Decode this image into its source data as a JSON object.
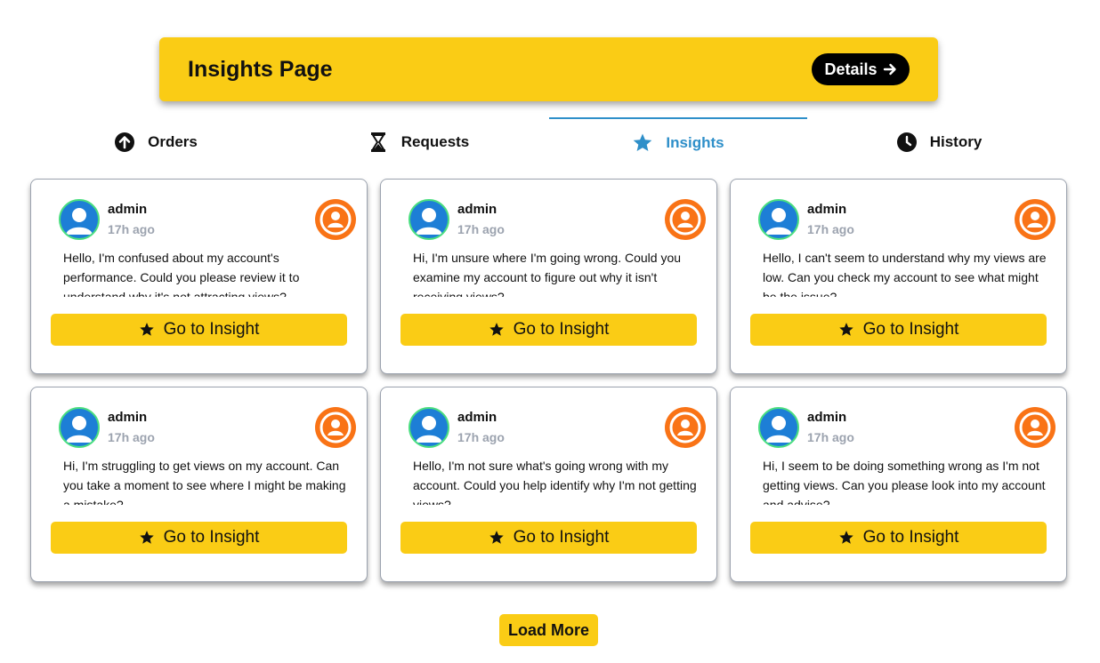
{
  "header": {
    "title": "Insights Page",
    "details_label": "Details",
    "details_icon": "arrow-right-icon"
  },
  "tabs": [
    {
      "label": "Orders",
      "icon": "arrow-up-circle-icon",
      "active": false
    },
    {
      "label": "Requests",
      "icon": "hourglass-icon",
      "active": false
    },
    {
      "label": "Insights",
      "icon": "star-icon",
      "active": true
    },
    {
      "label": "History",
      "icon": "clock-icon",
      "active": false
    }
  ],
  "cards": [
    {
      "user": "admin",
      "time": "17h ago",
      "message": "Hello, I'm confused about my account's performance. Could you please review it to understand why it's not attracting views?",
      "button": "Go to Insight"
    },
    {
      "user": "admin",
      "time": "17h ago",
      "message": "Hi, I'm unsure where I'm going wrong. Could you examine my account to figure out why it isn't receiving views?",
      "button": "Go to Insight"
    },
    {
      "user": "admin",
      "time": "17h ago",
      "message": "Hello, I can't seem to understand why my views are low. Can you check my account to see what might be the issue?",
      "button": "Go to Insight"
    },
    {
      "user": "admin",
      "time": "17h ago",
      "message": "Hi, I'm struggling to get views on my account. Can you take a moment to see where I might be making a mistake?",
      "button": "Go to Insight"
    },
    {
      "user": "admin",
      "time": "17h ago",
      "message": "Hello, I'm not sure what's going wrong with my account. Could you help identify why I'm not getting views?",
      "button": "Go to Insight"
    },
    {
      "user": "admin",
      "time": "17h ago",
      "message": "Hi, I seem to be doing something wrong as I'm not getting views. Can you please look into my account and advise?",
      "button": "Go to Insight"
    }
  ],
  "load_more_label": "Load More",
  "colors": {
    "accent_yellow": "#facc15",
    "active_tab_blue": "#2e8fc9",
    "avatar_blue": "#1d7ed6",
    "avatar_ring_green": "#4ade80",
    "user_icon_orange": "#f97316"
  }
}
